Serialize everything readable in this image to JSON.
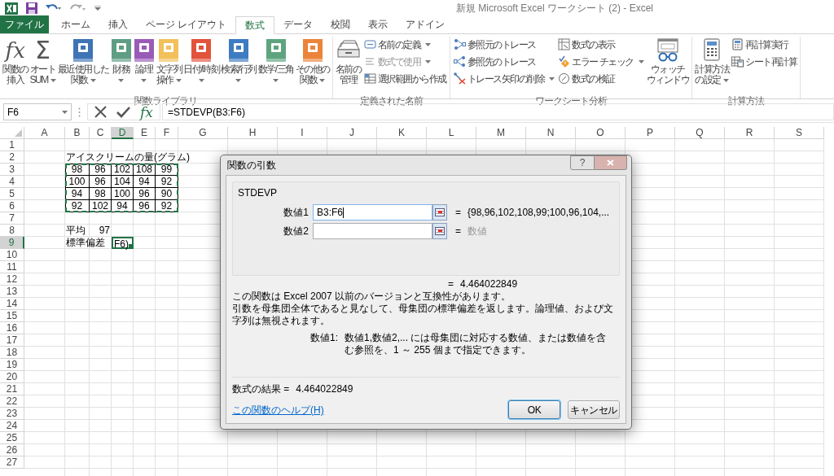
{
  "window": {
    "title": "新規 Microsoft Excel ワークシート (2) - Excel"
  },
  "tabs": [
    {
      "label": "ファイル",
      "kind": "file",
      "selected": false
    },
    {
      "label": "ホーム",
      "kind": "tab",
      "selected": false
    },
    {
      "label": "挿入",
      "kind": "tab",
      "selected": false
    },
    {
      "label": "ページ レイアウト",
      "kind": "tab",
      "selected": false
    },
    {
      "label": "数式",
      "kind": "tab",
      "selected": true
    },
    {
      "label": "データ",
      "kind": "tab",
      "selected": false
    },
    {
      "label": "校閲",
      "kind": "tab",
      "selected": false
    },
    {
      "label": "表示",
      "kind": "tab",
      "selected": false
    },
    {
      "label": "アドイン",
      "kind": "tab",
      "selected": false
    }
  ],
  "ribbon_groups": [
    {
      "label": "関数ライブラリ",
      "items": [
        {
          "kind": "large",
          "glyph": "fx",
          "lines": [
            "関数の",
            "挿入"
          ],
          "dropdown": false,
          "disabled": false
        },
        {
          "kind": "large",
          "glyph": "Σ",
          "lines": [
            "オート",
            "SUM"
          ],
          "dropdown": true,
          "disabled": false
        },
        {
          "kind": "large",
          "color": "#3f74b5",
          "lines": [
            "最近使用した",
            "関数"
          ],
          "dropdown": true,
          "disabled": false
        },
        {
          "kind": "large",
          "color": "#5f9e84",
          "lines": [
            "財務"
          ],
          "dropdown": true,
          "disabled": false
        },
        {
          "kind": "large",
          "color": "#9a5bb8",
          "lines": [
            "論理"
          ],
          "dropdown": true,
          "disabled": false
        },
        {
          "kind": "large",
          "color": "#f2c15c",
          "lines": [
            "文字列",
            "操作"
          ],
          "dropdown": true,
          "disabled": false
        },
        {
          "kind": "large",
          "color": "#e2533c",
          "lines": [
            "日付/時刻"
          ],
          "dropdown": true,
          "disabled": false
        },
        {
          "kind": "large",
          "color": "#3e7cc2",
          "lines": [
            "検索/行列"
          ],
          "dropdown": true,
          "disabled": false
        },
        {
          "kind": "large",
          "color": "#5ea47f",
          "lines": [
            "数学/三角"
          ],
          "dropdown": true,
          "disabled": false
        },
        {
          "kind": "large",
          "color": "#eb843b",
          "lines": [
            "その他の",
            "関数"
          ],
          "dropdown": true,
          "disabled": false
        }
      ]
    },
    {
      "label": "定義された名前",
      "items": [
        {
          "kind": "large",
          "lines": [
            "名前の",
            "管理"
          ],
          "dropdown": false,
          "disabled": false
        },
        {
          "kind": "small",
          "lines": [
            "名前の定義"
          ],
          "dropdown": true,
          "disabled": false
        },
        {
          "kind": "small",
          "lines": [
            "数式で使用"
          ],
          "dropdown": true,
          "disabled": true
        },
        {
          "kind": "small",
          "lines": [
            "選択範囲から作成"
          ],
          "dropdown": false,
          "disabled": false
        }
      ]
    },
    {
      "label": "ワークシート分析",
      "items": [
        {
          "kind": "small",
          "lines": [
            "参照元のトレース"
          ],
          "dropdown": false,
          "disabled": false
        },
        {
          "kind": "small",
          "lines": [
            "参照先のトレース"
          ],
          "dropdown": false,
          "disabled": false
        },
        {
          "kind": "small",
          "lines": [
            "トレース矢印の削除"
          ],
          "dropdown": true,
          "disabled": false
        },
        {
          "kind": "small",
          "lines": [
            "数式の表示"
          ],
          "dropdown": false,
          "disabled": false
        },
        {
          "kind": "small",
          "lines": [
            "エラー チェック"
          ],
          "dropdown": true,
          "disabled": false
        },
        {
          "kind": "small",
          "lines": [
            "数式の検証"
          ],
          "dropdown": false,
          "disabled": false
        },
        {
          "kind": "large",
          "lines": [
            "ウォッチ",
            "ウィンドウ"
          ],
          "dropdown": false,
          "disabled": false
        }
      ]
    },
    {
      "label": "計算方法",
      "items": [
        {
          "kind": "large",
          "lines": [
            "計算方法",
            "の設定"
          ],
          "dropdown": true,
          "disabled": false
        },
        {
          "kind": "small",
          "lines": [
            "再計算実行"
          ],
          "dropdown": false,
          "disabled": false
        },
        {
          "kind": "small",
          "lines": [
            "シート再計算"
          ],
          "dropdown": false,
          "disabled": false
        }
      ]
    }
  ],
  "name_box": {
    "value": "F6"
  },
  "formula_bar": {
    "fx": "fx",
    "formula": "=STDEVP(B3:F6)"
  },
  "sheet": {
    "columns": [
      {
        "label": "A",
        "selected": false
      },
      {
        "label": "B",
        "selected": false
      },
      {
        "label": "C",
        "selected": false
      },
      {
        "label": "D",
        "selected": true
      },
      {
        "label": "E",
        "selected": false
      },
      {
        "label": "F",
        "selected": false
      },
      {
        "label": "G",
        "selected": false
      },
      {
        "label": "H",
        "selected": false
      },
      {
        "label": "I",
        "selected": false
      },
      {
        "label": "J",
        "selected": false
      },
      {
        "label": "K",
        "selected": false
      },
      {
        "label": "L",
        "selected": false
      },
      {
        "label": "M",
        "selected": false
      },
      {
        "label": "N",
        "selected": false
      },
      {
        "label": "O",
        "selected": false
      },
      {
        "label": "P",
        "selected": false
      },
      {
        "label": "Q",
        "selected": false
      },
      {
        "label": "R",
        "selected": false
      },
      {
        "label": "S",
        "selected": false
      }
    ],
    "rows": [
      {
        "label": "1",
        "selected": false
      },
      {
        "label": "2",
        "selected": false,
        "cells": {
          "B": {
            "kind": "text",
            "text": "アイスクリームの量(グラム)",
            "selected": false
          }
        }
      },
      {
        "label": "3",
        "selected": false,
        "cells": {
          "B": {
            "kind": "boxed",
            "text": "98",
            "selected": false
          },
          "C": {
            "kind": "boxed",
            "text": "96",
            "selected": false
          },
          "D": {
            "kind": "boxed",
            "text": "102",
            "selected": false
          },
          "E": {
            "kind": "boxed",
            "text": "108",
            "selected": false
          },
          "F": {
            "kind": "boxed",
            "text": "99",
            "selected": false
          }
        }
      },
      {
        "label": "4",
        "selected": false,
        "cells": {
          "B": {
            "kind": "boxed",
            "text": "100",
            "selected": false
          },
          "C": {
            "kind": "boxed",
            "text": "96",
            "selected": false
          },
          "D": {
            "kind": "boxed",
            "text": "104",
            "selected": false
          },
          "E": {
            "kind": "boxed",
            "text": "94",
            "selected": false
          },
          "F": {
            "kind": "boxed",
            "text": "92",
            "selected": false
          }
        }
      },
      {
        "label": "5",
        "selected": false,
        "cells": {
          "B": {
            "kind": "boxed",
            "text": "94",
            "selected": false
          },
          "C": {
            "kind": "boxed",
            "text": "98",
            "selected": false
          },
          "D": {
            "kind": "boxed",
            "text": "100",
            "selected": false
          },
          "E": {
            "kind": "boxed",
            "text": "96",
            "selected": false
          },
          "F": {
            "kind": "boxed",
            "text": "90",
            "selected": false
          }
        }
      },
      {
        "label": "6",
        "selected": false,
        "cells": {
          "B": {
            "kind": "boxed",
            "text": "92",
            "selected": false
          },
          "C": {
            "kind": "boxed",
            "text": "102",
            "selected": false
          },
          "D": {
            "kind": "boxed",
            "text": "94",
            "selected": false
          },
          "E": {
            "kind": "boxed",
            "text": "96",
            "selected": false
          },
          "F": {
            "kind": "boxed",
            "text": "92",
            "selected": false
          }
        }
      },
      {
        "label": "7",
        "selected": false
      },
      {
        "label": "8",
        "selected": false,
        "cells": {
          "B": {
            "kind": "text",
            "text": "平均",
            "selected": false
          },
          "C": {
            "kind": "number",
            "text": "97",
            "selected": false
          }
        }
      },
      {
        "label": "9",
        "selected": true,
        "cells": {
          "B": {
            "kind": "text",
            "text": "標準偏差",
            "selected": false
          },
          "D": {
            "kind": "text",
            "text": "F6)",
            "selected": true
          }
        }
      },
      {
        "label": "10",
        "selected": false
      },
      {
        "label": "11",
        "selected": false
      },
      {
        "label": "12",
        "selected": false
      },
      {
        "label": "13",
        "selected": false
      },
      {
        "label": "14",
        "selected": false
      },
      {
        "label": "15",
        "selected": false
      },
      {
        "label": "16",
        "selected": false
      },
      {
        "label": "17",
        "selected": false
      },
      {
        "label": "18",
        "selected": false
      },
      {
        "label": "19",
        "selected": false
      },
      {
        "label": "20",
        "selected": false
      },
      {
        "label": "21",
        "selected": false
      },
      {
        "label": "22",
        "selected": false
      },
      {
        "label": "23",
        "selected": false
      },
      {
        "label": "24",
        "selected": false
      },
      {
        "label": "25",
        "selected": false
      },
      {
        "label": "26",
        "selected": false
      },
      {
        "label": "27",
        "selected": false
      }
    ],
    "copy_marquee": true
  },
  "dialog": {
    "title": "関数の引数",
    "help_button": "?",
    "function_name": "STDEVP",
    "arguments": [
      {
        "label": "数値1",
        "value": "B3:F6",
        "focused": true,
        "equals": "=",
        "result": "{98,96,102,108,99;100,96,104,...",
        "dimmed": false
      },
      {
        "label": "数値2",
        "focused": false,
        "equals": "=",
        "result": "数値",
        "dimmed": true
      }
    ],
    "formula_equals": "=",
    "formula_value": "4.464022849",
    "description": [
      "この関数は Excel 2007 以前のバージョンと互換性があります。",
      "引数を母集団全体であると見なして、母集団の標準偏差を返します。論理値、および文字列は無視されます。"
    ],
    "argument_help": {
      "label": "数値1:",
      "text": "数値1,数値2,... には母集団に対応する数値、または数値を含む参照を、1 ～ 255 個まで指定できます。"
    },
    "result_label": "数式の結果 =",
    "result_value": "4.464022849",
    "help_link": "この関数のヘルプ(H)",
    "buttons": [
      {
        "label": "OK",
        "default": true
      },
      {
        "label": "キャンセル",
        "default": false
      }
    ]
  }
}
